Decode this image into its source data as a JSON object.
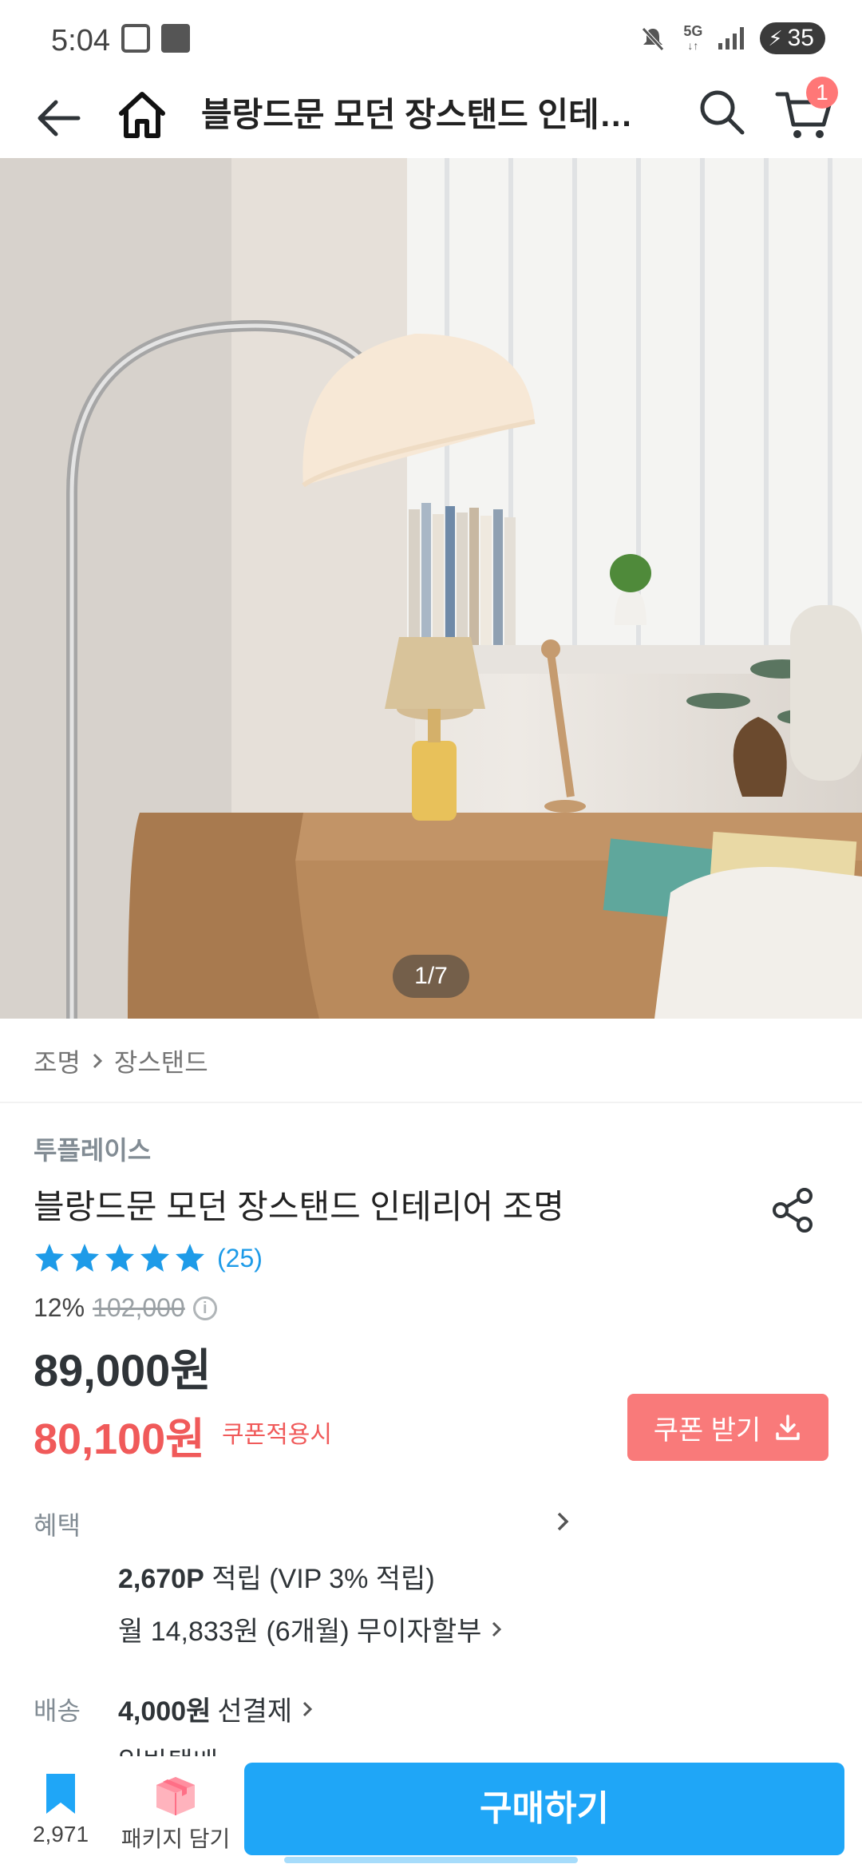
{
  "status_bar": {
    "time": "5:04",
    "network": "5G",
    "battery": "35",
    "icons": [
      "screenshot-icon",
      "notification-icon",
      "mute-icon",
      "signal-icon",
      "battery-icon"
    ]
  },
  "header": {
    "title": "블랑드문 모던 장스탠드 인테리...",
    "cart_count": "1",
    "icons": [
      "back-arrow-icon",
      "home-icon",
      "search-icon",
      "cart-icon"
    ]
  },
  "gallery": {
    "indicator": "1/7"
  },
  "breadcrumb": {
    "items": [
      "조명",
      "장스탠드"
    ]
  },
  "product": {
    "brand": "투플레이스",
    "name": "블랑드문 모던 장스탠드 인테리어 조명",
    "rating": 5,
    "review_count": "(25)",
    "discount": "12%",
    "original_price": "102,000",
    "price": "89,000원",
    "coupon_price": "80,100원",
    "coupon_note": "쿠폰적용시",
    "coupon_button": "쿠폰 받기"
  },
  "benefits": {
    "label": "혜택",
    "points_value": "2,670P",
    "points_text": "적립 (VIP 3% 적립)",
    "installment": "월 14,833원 (6개월) 무이자할부"
  },
  "shipping": {
    "label": "배송",
    "fee": "4,000원",
    "type": "선결제",
    "next_line": "일반택배"
  },
  "bottom_bar": {
    "bookmark_count": "2,971",
    "package_label": "패키지 담기",
    "buy_label": "구매하기"
  },
  "colors": {
    "accent": "#1fa6f7",
    "coupon": "#f05a5a",
    "coupon_button": "#f97a7a",
    "star": "#1e9be8",
    "badge": "#ff7777"
  }
}
